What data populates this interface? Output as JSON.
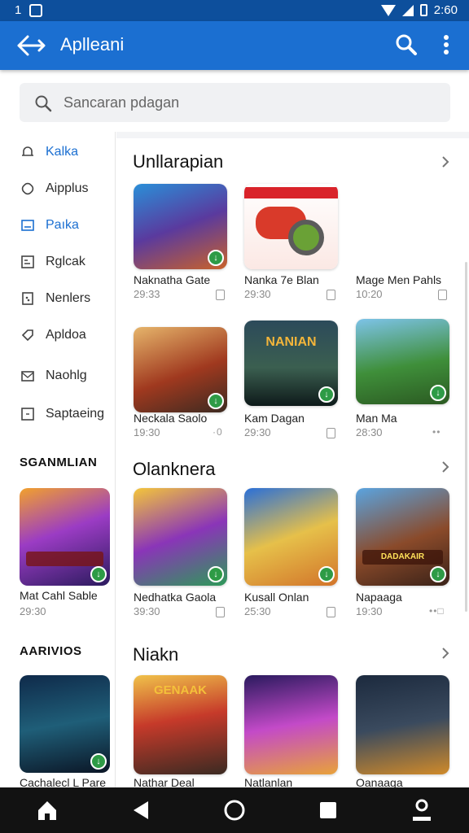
{
  "status_bar": {
    "left_text": "1",
    "time": "2:60"
  },
  "app_bar": {
    "title": "Aplleani"
  },
  "search": {
    "placeholder": "Sancaran pdagan"
  },
  "sidebar": {
    "items": [
      {
        "label": "Kalka",
        "icon": "bell-icon",
        "active": true
      },
      {
        "label": "Aipplus",
        "icon": "tag-icon",
        "active": false
      },
      {
        "label": "Paıka",
        "icon": "image-icon",
        "active": true
      },
      {
        "label": "Rglcak",
        "icon": "document-icon",
        "active": false
      },
      {
        "label": "Nenlers",
        "icon": "calendar-icon",
        "active": false
      },
      {
        "label": "Apldoa",
        "icon": "label-icon",
        "active": false
      },
      {
        "label": "Naohlg",
        "icon": "mail-icon",
        "active": false
      },
      {
        "label": "Saptaeing",
        "icon": "square-icon",
        "active": false
      }
    ],
    "sections": [
      {
        "heading": "SGANMLIAN",
        "card_name": "Mat Cahl Sable",
        "card_meta": "29:30"
      },
      {
        "heading": "AARIVIOS",
        "card_name": "Cachalecl L Pare",
        "card_meta": ""
      }
    ]
  },
  "sections": [
    {
      "title": "Unllarapian",
      "apps": [
        {
          "name": "Naknatha Gate",
          "meta": "29:33",
          "label": ""
        },
        {
          "name": "Nanka 7e Blan",
          "meta": "29:30",
          "label": ""
        },
        {
          "name": "Mage Men Pahls",
          "meta": "10:20",
          "label": ""
        },
        {
          "name": "Neckala Saolo",
          "meta": "19:30",
          "label": ""
        },
        {
          "name": "Kam Dagan",
          "meta": "29:30",
          "label": "NANIAN"
        },
        {
          "name": "Man Ma",
          "meta": "28:30",
          "label": ""
        }
      ]
    },
    {
      "title": "Olanknera",
      "apps": [
        {
          "name": "Nedhatka Gaola",
          "meta": "39:30",
          "label": ""
        },
        {
          "name": "Kusall Onlan",
          "meta": "25:30",
          "label": ""
        },
        {
          "name": "Napaaga",
          "meta": "19:30",
          "label": "DADAKAIR"
        }
      ]
    },
    {
      "title": "Niakn",
      "apps": [
        {
          "name": "Nathar Deal",
          "meta": "",
          "label": "GENAAK"
        },
        {
          "name": "Natlanlan",
          "meta": "",
          "label": ""
        },
        {
          "name": "Oanaaga",
          "meta": "",
          "label": ""
        }
      ]
    }
  ],
  "colors": {
    "primary": "#1b6fd1",
    "status_bar": "#0d4f9c",
    "badge": "#2e9b46"
  }
}
